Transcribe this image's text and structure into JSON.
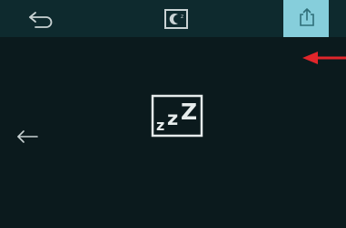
{
  "colors": {
    "background": "#0b1a1d",
    "topbar": "#0e2a2e",
    "export_button_bg": "#86cedb",
    "icon_light": "#c9d3d4",
    "annotation_red": "#e0262b"
  },
  "topbar": {
    "back_icon": "curved-back-arrow-icon",
    "mode_icon": "sleep-mode-icon",
    "export_icon": "export-icon"
  },
  "main": {
    "sleep_icon": "zzz-sleep-icon",
    "sleep_text": "zzZ",
    "nav_back_icon": "left-arrow-icon"
  },
  "annotation": {
    "pointer": "red-arrow-pointer"
  }
}
